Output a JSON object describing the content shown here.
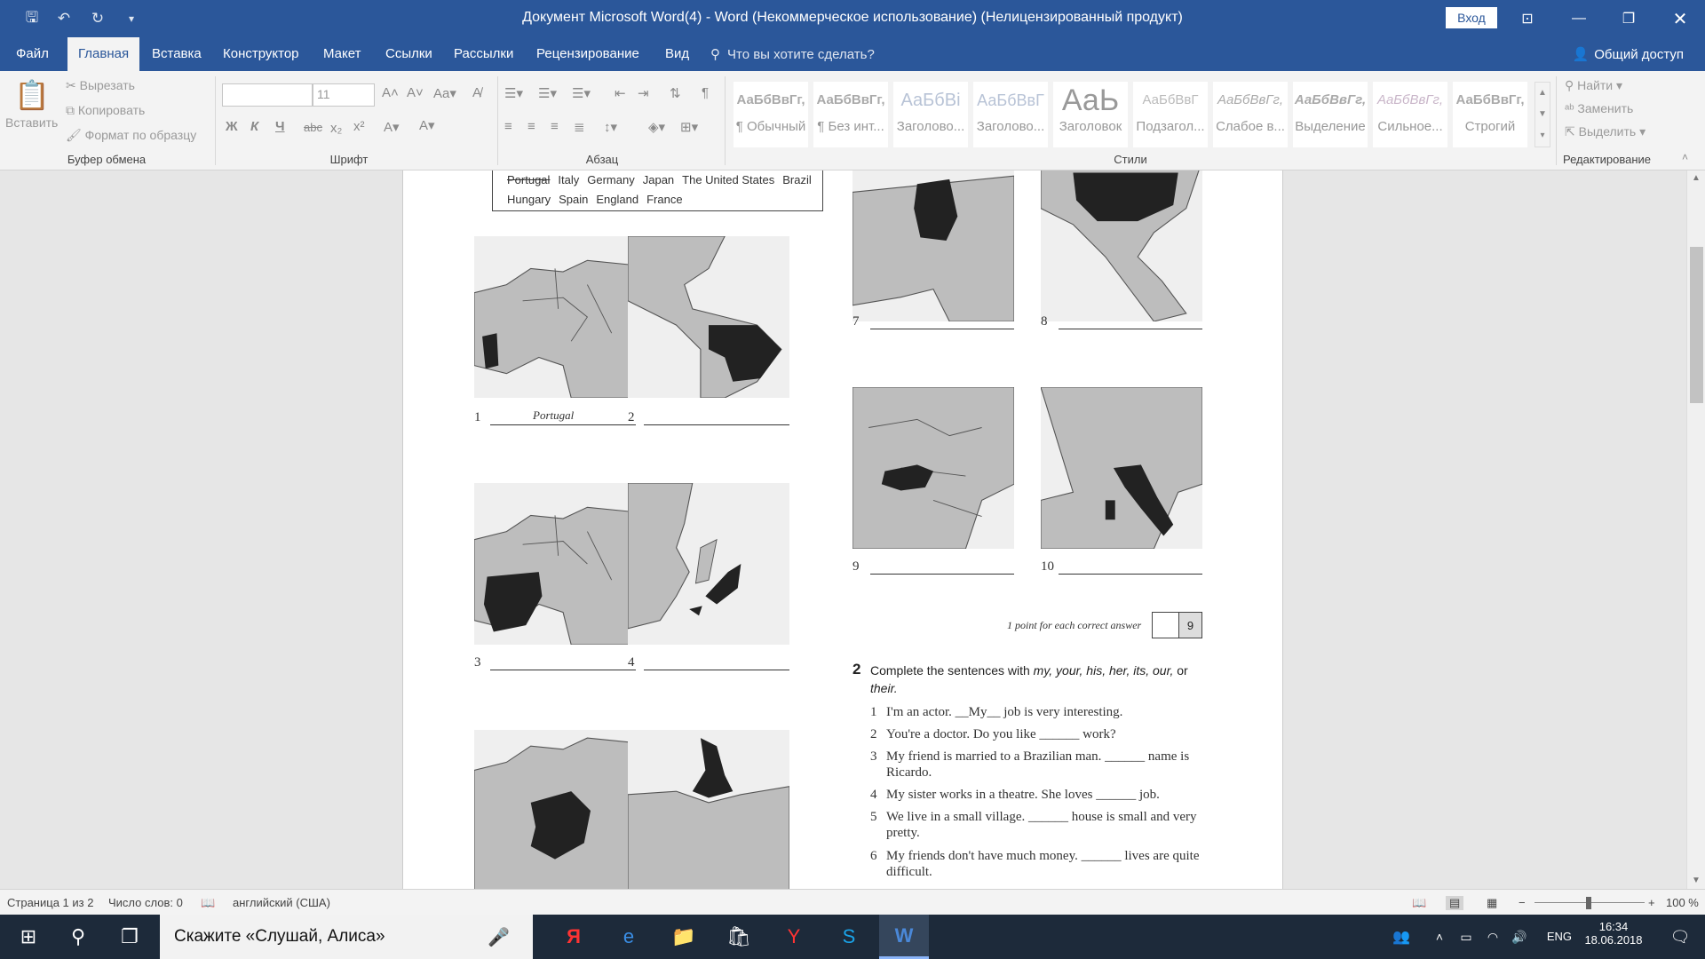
{
  "window": {
    "title": "Документ Microsoft Word(4)  -  Word (Некоммерческое использование) (Нелицензированный продукт)",
    "signin": "Вход"
  },
  "tabs": [
    "Файл",
    "Главная",
    "Вставка",
    "Конструктор",
    "Макет",
    "Ссылки",
    "Рассылки",
    "Рецензирование",
    "Вид"
  ],
  "tellme": "Что вы хотите сделать?",
  "share": "Общий доступ",
  "ribbon": {
    "clipboard": {
      "paste": "Вставить",
      "cut": "Вырезать",
      "copy": "Копировать",
      "format_painter": "Формат по образцу",
      "label": "Буфер обмена"
    },
    "font": {
      "size": "11",
      "label": "Шрифт",
      "bold": "Ж",
      "italic": "К",
      "underline": "Ч",
      "strike": "abc",
      "sub": "x₂",
      "sup": "x²"
    },
    "paragraph": {
      "label": "Абзац"
    },
    "styles": {
      "label": "Стили",
      "items": [
        {
          "sample": "АаБбВвГг,",
          "name": "¶ Обычный"
        },
        {
          "sample": "АаБбВвГг,",
          "name": "¶ Без инт..."
        },
        {
          "sample": "АаБбВі",
          "name": "Заголово..."
        },
        {
          "sample": "АаБбВвГ",
          "name": "Заголово..."
        },
        {
          "sample": "АаЬ",
          "name": "Заголовок"
        },
        {
          "sample": "АаБбВвГ",
          "name": "Подзагол..."
        },
        {
          "sample": "АаБбВвГг,",
          "name": "Слабое в..."
        },
        {
          "sample": "АаБбВвГг,",
          "name": "Выделение"
        },
        {
          "sample": "АаБбВвГг,",
          "name": "Сильное..."
        },
        {
          "sample": "АаБбВвГг,",
          "name": "Строгий"
        }
      ]
    },
    "editing": {
      "find": "Найти",
      "replace": "Заменить",
      "select": "Выделить",
      "label": "Редактирование"
    }
  },
  "document": {
    "wordbox_line1": [
      "Portugal",
      "Italy",
      "Germany",
      "Japan",
      "The United States",
      "Brazil"
    ],
    "wordbox_line2": [
      "Hungary",
      "Spain",
      "England",
      "France"
    ],
    "questions": [
      {
        "num": "1",
        "answer": "Portugal"
      },
      {
        "num": "2",
        "answer": ""
      },
      {
        "num": "3",
        "answer": ""
      },
      {
        "num": "4",
        "answer": ""
      },
      {
        "num": "7",
        "answer": ""
      },
      {
        "num": "8",
        "answer": ""
      },
      {
        "num": "9",
        "answer": ""
      },
      {
        "num": "10",
        "answer": ""
      }
    ],
    "points_label": "1 point for each correct answer",
    "points_value": "9",
    "ex2_num": "2",
    "ex2_instruction_prefix": "Complete the sentences with ",
    "ex2_words": "my, your, his, her, its, our,",
    "ex2_or": " or ",
    "ex2_last": "their.",
    "sentences": [
      {
        "n": "1",
        "t": "I'm an actor. __My__ job is very interesting."
      },
      {
        "n": "2",
        "t": "You're a doctor. Do you like ______ work?"
      },
      {
        "n": "3",
        "t": "My friend is married to a Brazilian man. ______ name is Ricardo."
      },
      {
        "n": "4",
        "t": "My sister works in a theatre. She loves ______ job."
      },
      {
        "n": "5",
        "t": "We live in a small village. ______ house is small and very pretty."
      },
      {
        "n": "6",
        "t": "My friends don't have much money. ______ lives are quite difficult."
      }
    ]
  },
  "status": {
    "page": "Страница 1 из 2",
    "words": "Число слов: 0",
    "language": "английский (США)",
    "zoom": "100 %"
  },
  "taskbar": {
    "search": "Скажите «Слушай, Алиса»",
    "lang": "ENG",
    "time": "16:34",
    "date": "18.06.2018"
  }
}
